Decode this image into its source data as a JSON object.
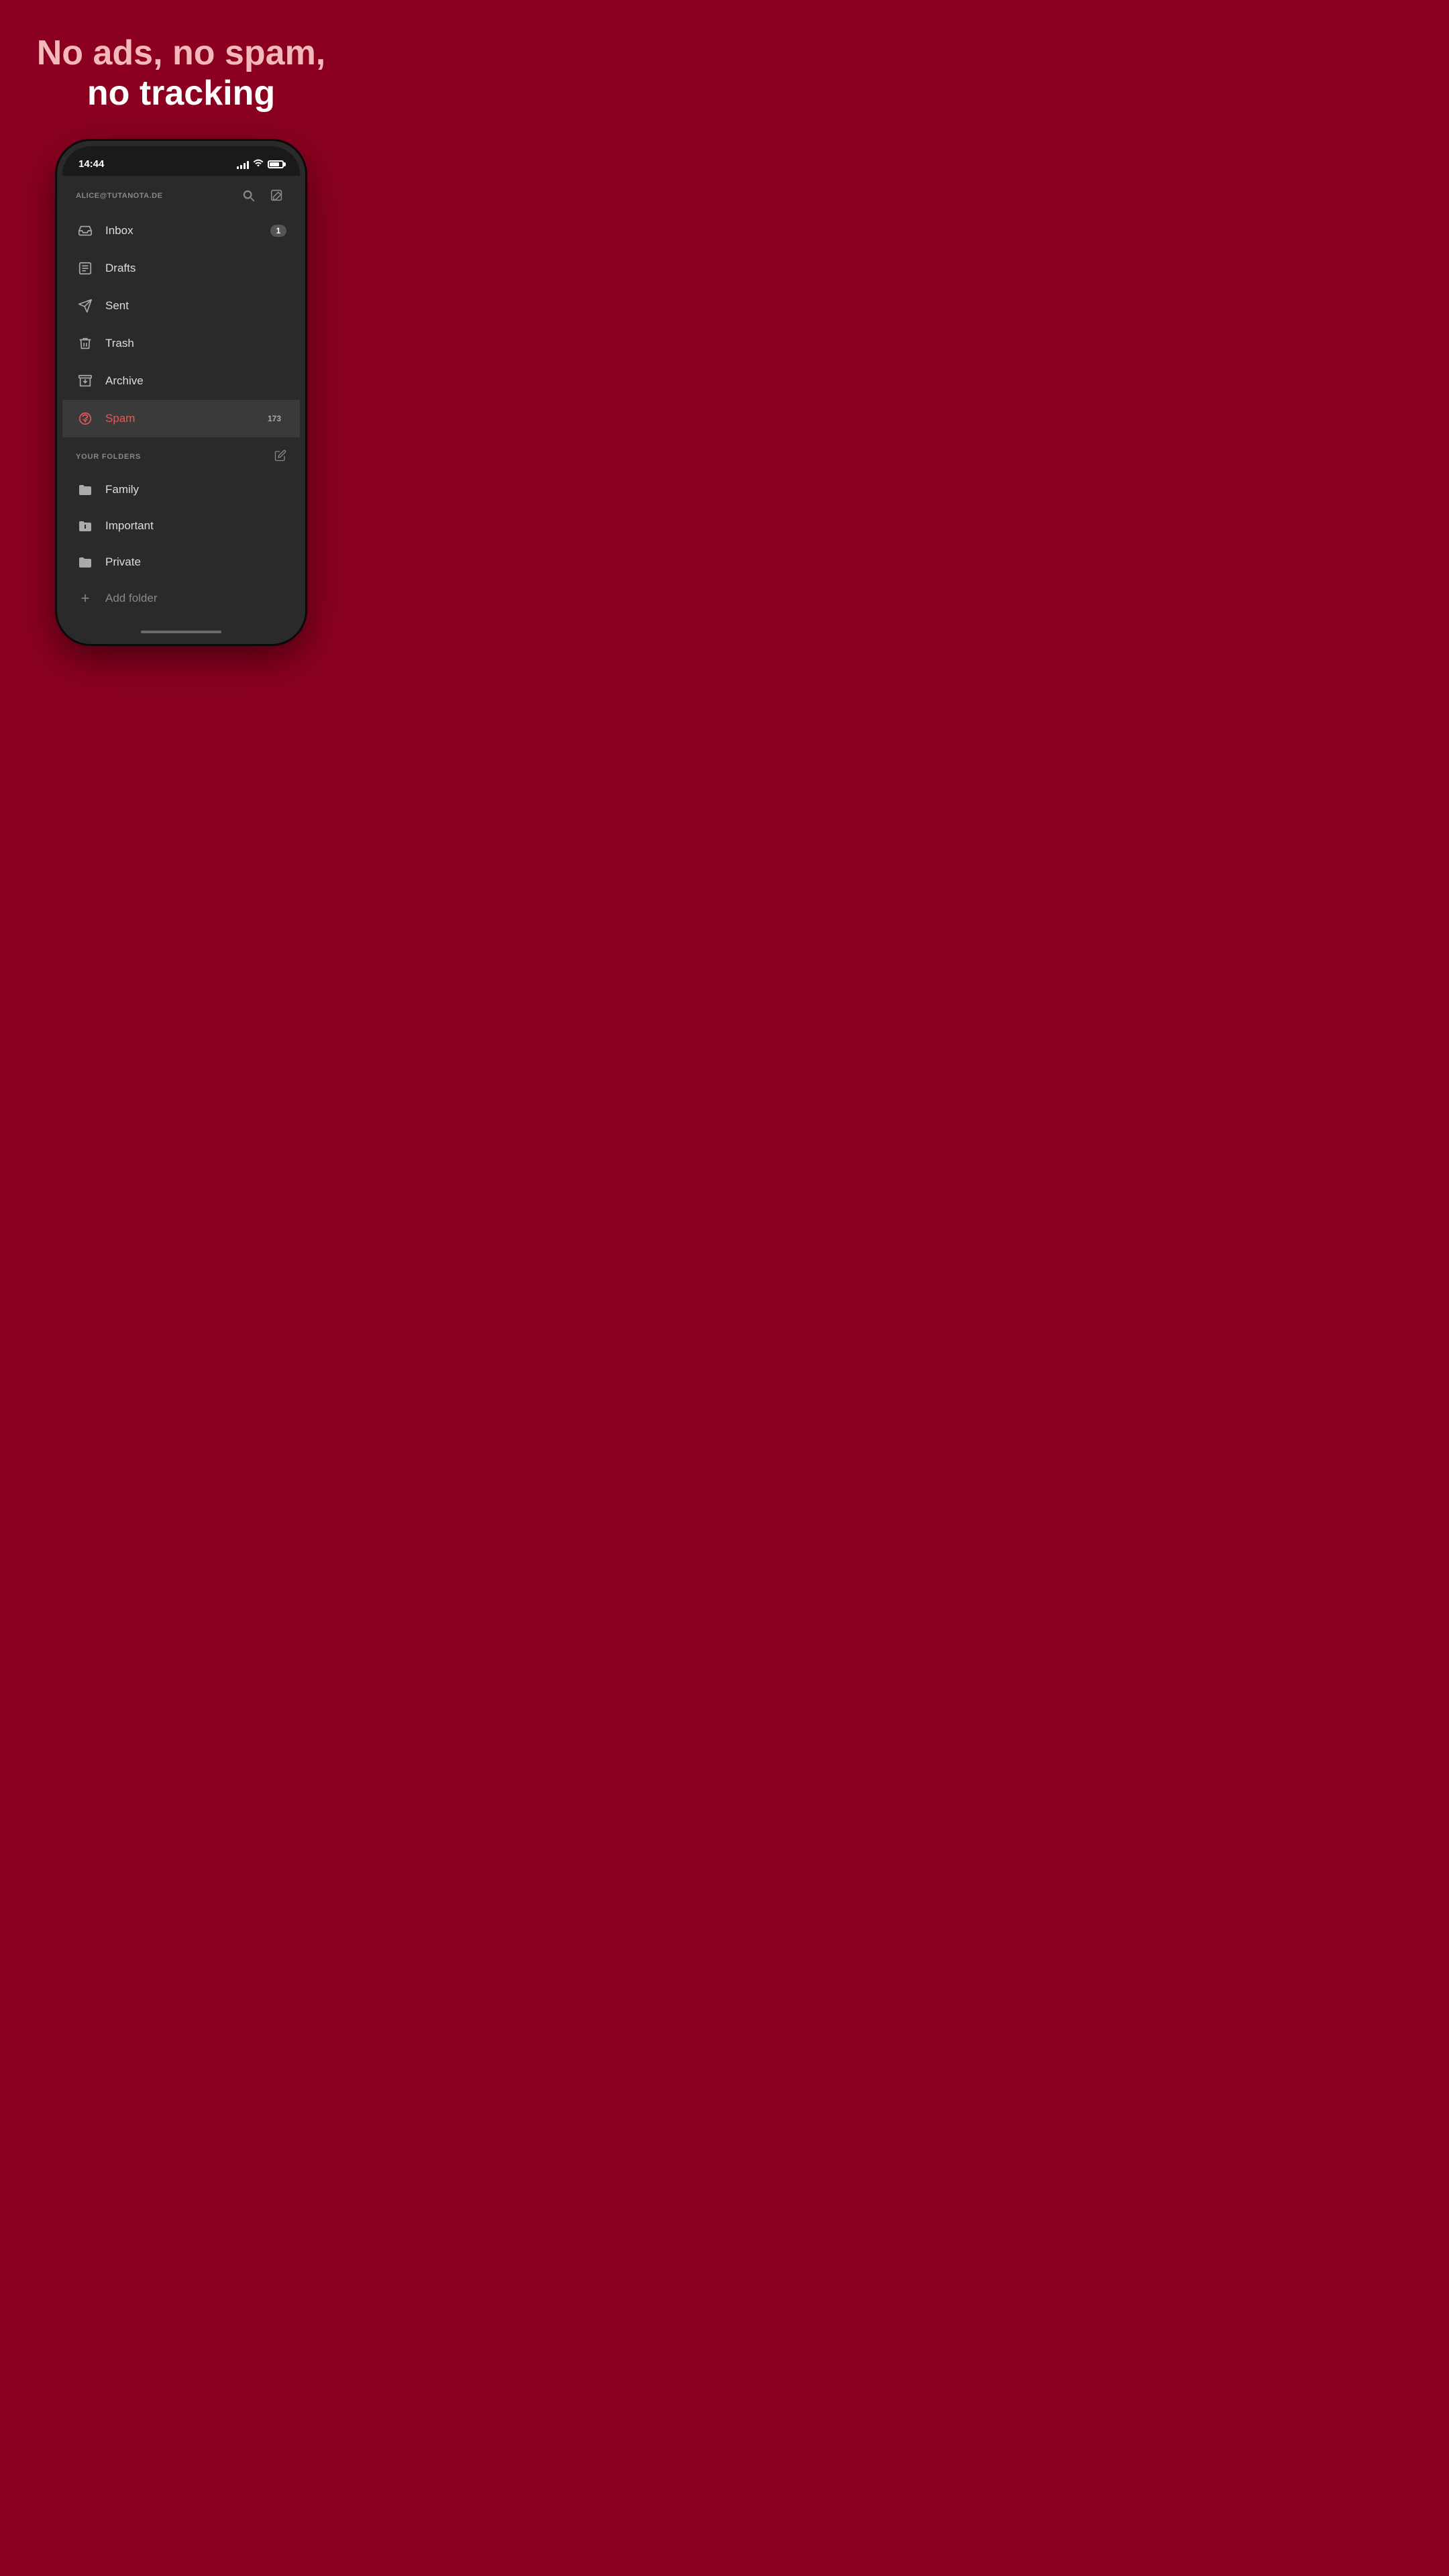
{
  "headline": {
    "line1": "No ads, no spam,",
    "line2": "no tracking"
  },
  "statusBar": {
    "time": "14:44",
    "signal": [
      3,
      5,
      7,
      9,
      11
    ],
    "battery": "80"
  },
  "account": {
    "email": "ALICE@TUTANOTA.DE"
  },
  "navItems": [
    {
      "id": "inbox",
      "label": "Inbox",
      "badge": "1",
      "active": false
    },
    {
      "id": "drafts",
      "label": "Drafts",
      "badge": "",
      "active": false
    },
    {
      "id": "sent",
      "label": "Sent",
      "badge": "",
      "active": false
    },
    {
      "id": "trash",
      "label": "Trash",
      "badge": "",
      "active": false
    },
    {
      "id": "archive",
      "label": "Archive",
      "badge": "",
      "active": false
    },
    {
      "id": "spam",
      "label": "Spam",
      "badge": "173",
      "active": true
    }
  ],
  "foldersSection": {
    "title": "YOUR FOLDERS",
    "items": [
      {
        "id": "family",
        "label": "Family"
      },
      {
        "id": "important",
        "label": "Important"
      },
      {
        "id": "private",
        "label": "Private"
      }
    ],
    "addLabel": "Add folder"
  }
}
